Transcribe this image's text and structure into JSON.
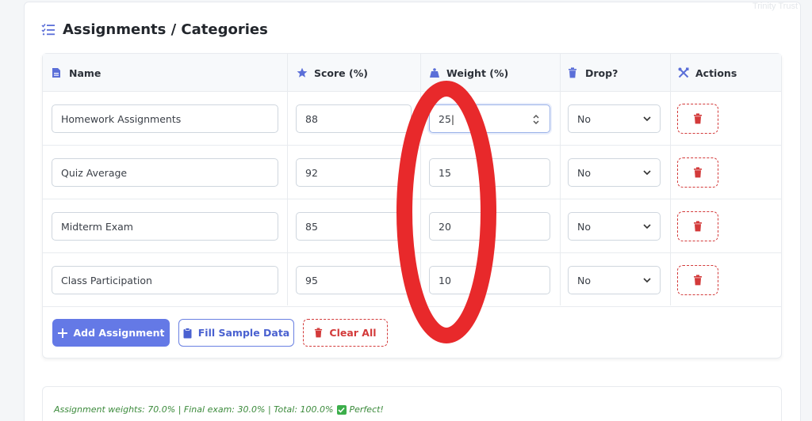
{
  "watermark": "Trinity Trust",
  "section": {
    "title": "Assignments / Categories",
    "icon": "tasks-list-icon"
  },
  "columns": {
    "name": {
      "label": "Name",
      "icon": "file-icon"
    },
    "score": {
      "label": "Score (%)",
      "icon": "star-icon"
    },
    "weight": {
      "label": "Weight (%)",
      "icon": "weight-icon"
    },
    "drop": {
      "label": "Drop?",
      "icon": "trash-icon"
    },
    "actions": {
      "label": "Actions",
      "icon": "tools-icon"
    }
  },
  "rows": [
    {
      "name": "Homework Assignments",
      "score": "88",
      "weight": "25",
      "drop": "No"
    },
    {
      "name": "Quiz Average",
      "score": "92",
      "weight": "15",
      "drop": "No"
    },
    {
      "name": "Midterm Exam",
      "score": "85",
      "weight": "20",
      "drop": "No"
    },
    {
      "name": "Class Participation",
      "score": "95",
      "weight": "10",
      "drop": "No"
    }
  ],
  "buttons": {
    "add": "Add Assignment",
    "fill": "Fill Sample Data",
    "clear": "Clear All"
  },
  "summary": {
    "text": "Assignment weights: 70.0% | Final exam: 30.0% | Total: 100.0%",
    "status": "Perfect!"
  },
  "colors": {
    "accent": "#6479e6",
    "danger": "#d33a3a",
    "success": "#3cae4b",
    "annotation": "#e8292b"
  }
}
